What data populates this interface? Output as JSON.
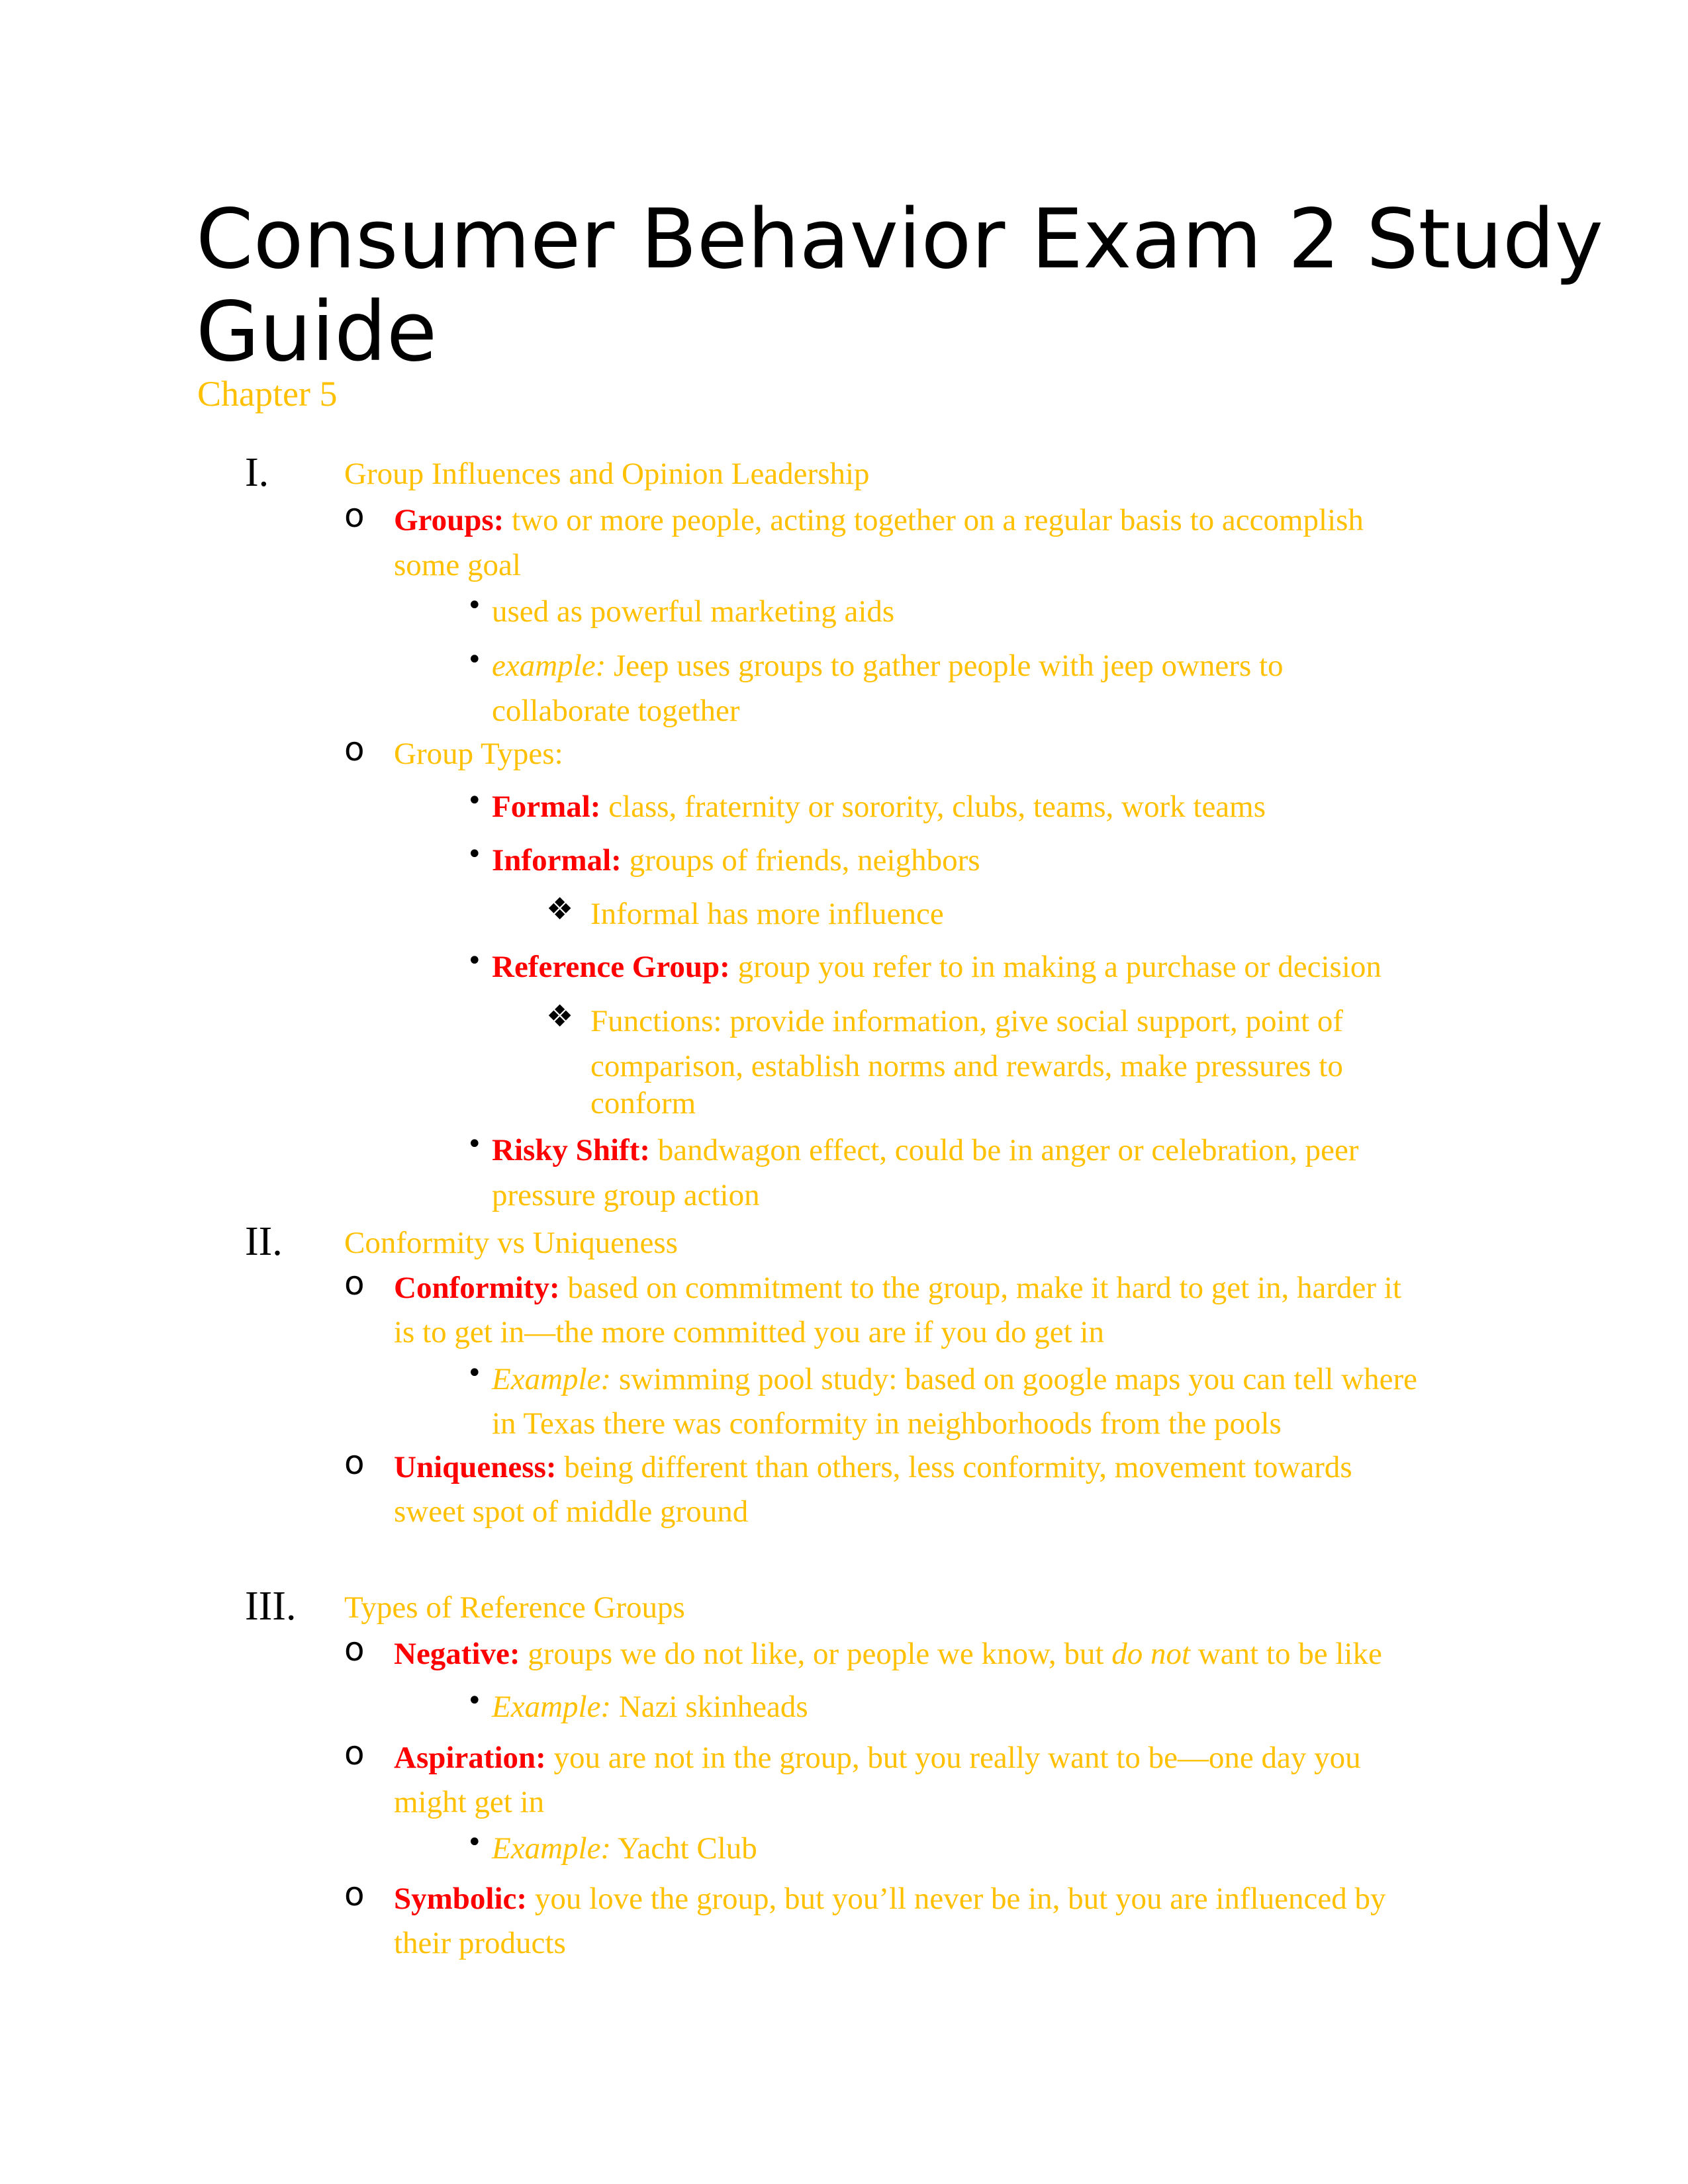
{
  "document": {
    "title_line1": "Consumer Behavior Exam 2 Study",
    "title_line2": "Guide",
    "chapter": "Chapter 5",
    "colors": {
      "heading_text": "#FFC000",
      "term": "#FF0000",
      "marker": "#000000",
      "title": "#000000"
    },
    "sections": [
      {
        "numeral": "I.",
        "heading": "Group Influences and Opinion Leadership",
        "items": [
          {
            "marker": "o",
            "term": "Groups:",
            "text_line1": " two or more people, acting together on a regular basis to accomplish",
            "text_line2": "some goal",
            "subitems": [
              {
                "marker": "•",
                "text": "used as powerful marketing aids"
              },
              {
                "marker": "•",
                "italic": "example:",
                "text_line1": " Jeep uses groups to gather people with jeep owners to",
                "text_line2": "collaborate together"
              }
            ]
          },
          {
            "marker": "o",
            "text": "Group Types:",
            "subitems": [
              {
                "marker": "•",
                "term": "Formal:",
                "text": " class, fraternity or sorority, clubs, teams, work teams"
              },
              {
                "marker": "•",
                "term": "Informal:",
                "text": " groups of friends, neighbors",
                "subitems": [
                  {
                    "marker": "❖",
                    "text": "Informal has more influence"
                  }
                ]
              },
              {
                "marker": "•",
                "term": "Reference Group:",
                "text": " group you refer to in making a purchase or decision",
                "subitems": [
                  {
                    "marker": "❖",
                    "text_line1": "Functions: provide information, give social support, point of",
                    "text_line2": "comparison, establish norms and rewards, make pressures to",
                    "text_line3": "conform"
                  }
                ]
              },
              {
                "marker": "•",
                "term": "Risky Shift:",
                "text_line1": " bandwagon effect, could be in anger or celebration, peer",
                "text_line2": "pressure group action"
              }
            ]
          }
        ]
      },
      {
        "numeral": "II.",
        "heading": "Conformity vs Uniqueness",
        "items": [
          {
            "marker": "o",
            "term": "Conformity:",
            "text_line1": " based on commitment to the group, make it hard to get in, harder it",
            "text_line2": "is to get in—the more committed you are if you do get in",
            "subitems": [
              {
                "marker": "•",
                "italic": "Example:",
                "text_line1": " swimming pool study: based on google maps you can tell where",
                "text_line2": "in Texas there was conformity in neighborhoods from the pools"
              }
            ]
          },
          {
            "marker": "o",
            "term": "Uniqueness:",
            "text_line1": " being different than others, less conformity, movement towards",
            "text_line2": "sweet spot of middle ground"
          }
        ]
      },
      {
        "numeral": "III.",
        "heading": "Types of Reference Groups",
        "items": [
          {
            "marker": "o",
            "term": "Negative:",
            "text_a": " groups we do not like, or people we know, but ",
            "italic": "do not",
            "text_b": " want to be like",
            "subitems": [
              {
                "marker": "•",
                "italic": "Example:",
                "text": " Nazi skinheads"
              }
            ]
          },
          {
            "marker": "o",
            "term": "Aspiration:",
            "text_line1": " you are not in the group, but you really want to be—one day you",
            "text_line2": "might get in",
            "subitems": [
              {
                "marker": "•",
                "italic": "Example:",
                "text": " Yacht Club"
              }
            ]
          },
          {
            "marker": "o",
            "term": "Symbolic:",
            "text_line1": " you love the group, but you’ll never be in, but you are influenced by",
            "text_line2": "their products"
          }
        ]
      }
    ]
  }
}
